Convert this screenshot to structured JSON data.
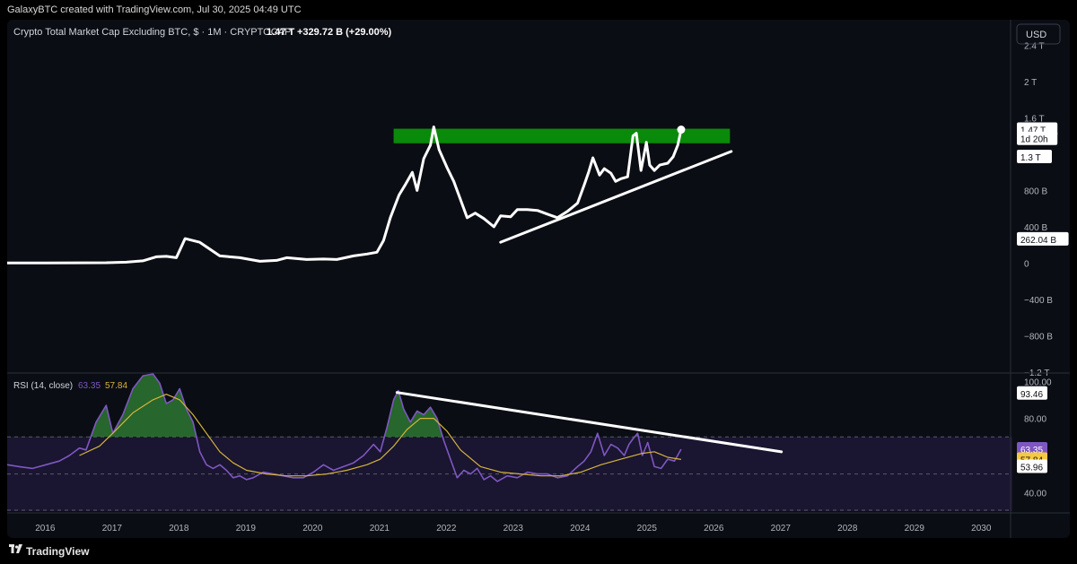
{
  "header": {
    "credit": "GalaxyBTC created with TradingView.com, Jul 30, 2025 04:49 UTC"
  },
  "footer": {
    "brand": "TradingView"
  },
  "colors": {
    "panel": "#0b0d14",
    "price_line": "#ffffff",
    "resistance_zone": "#0a8a0a",
    "rsi_line": "#7e57c2",
    "rsi_ma": "#d4b43c",
    "rsi_band": "#1a1530",
    "overbought_fill": "#2e7d32"
  },
  "chart_data": [
    {
      "type": "line",
      "title": "Crypto Total Market Cap Excluding BTC, $ · 1M · CRYPTOCAP",
      "legend": {
        "last": "1.47 T",
        "change": "+329.72 B (+29.00%)"
      },
      "currency_button": "USD",
      "y_ticks": [
        "2.4 T",
        "2 T",
        "1.6 T",
        "1.2 T",
        "800 B",
        "400 B",
        "0",
        "−400 B",
        "−800 B",
        "−1.2 T"
      ],
      "y_tick_values": [
        2400,
        2000,
        1600,
        1200,
        800,
        400,
        0,
        -400,
        -800,
        -1200
      ],
      "ylim": [
        -1200,
        2680
      ],
      "y_unit": "B USD",
      "price_labels": [
        {
          "text": "1.47 T",
          "value": 1470
        },
        {
          "text": "1d 20h",
          "value": 1370
        },
        {
          "text": "1.3 T",
          "value": 1170
        },
        {
          "text": "262.04 B",
          "value": 262
        }
      ],
      "x_ticks": [
        "2016",
        "2017",
        "2018",
        "2019",
        "2020",
        "2021",
        "2022",
        "2023",
        "2024",
        "2025",
        "2026",
        "2027",
        "2028",
        "2029",
        "2030"
      ],
      "x_tick_years": [
        2016,
        2017,
        2018,
        2019,
        2020,
        2021,
        2022,
        2023,
        2024,
        2025,
        2026,
        2027,
        2028,
        2029,
        2030
      ],
      "xlim": [
        2015.42,
        2030.32
      ],
      "series": [
        {
          "x": [
            2015.42,
            2016.0,
            2016.5,
            2016.9,
            2017.2,
            2017.45,
            2017.65,
            2017.8,
            2017.95,
            2018.08,
            2018.3,
            2018.6,
            2018.9,
            2019.2,
            2019.45,
            2019.6,
            2019.9,
            2020.15,
            2020.35,
            2020.6,
            2020.8,
            2020.95,
            2021.05,
            2021.15,
            2021.28,
            2021.38,
            2021.48,
            2021.55,
            2021.65,
            2021.75,
            2021.8,
            2021.88,
            2022.0,
            2022.1,
            2022.2,
            2022.3,
            2022.42,
            2022.55,
            2022.7,
            2022.8,
            2022.95,
            2023.05,
            2023.2,
            2023.35,
            2023.5,
            2023.65,
            2023.8,
            2023.95,
            2024.05,
            2024.12,
            2024.18,
            2024.28,
            2024.35,
            2024.45,
            2024.52,
            2024.6,
            2024.7,
            2024.78,
            2024.83,
            2024.9,
            2024.98,
            2025.03,
            2025.1,
            2025.18,
            2025.3,
            2025.38,
            2025.45,
            2025.5
          ],
          "y": [
            2,
            2,
            3,
            4,
            10,
            25,
            70,
            75,
            60,
            270,
            230,
            80,
            60,
            20,
            30,
            60,
            40,
            45,
            40,
            80,
            100,
            120,
            250,
            500,
            750,
            870,
            1000,
            800,
            1150,
            1300,
            1500,
            1250,
            1050,
            900,
            700,
            500,
            550,
            490,
            400,
            520,
            510,
            590,
            590,
            580,
            540,
            500,
            570,
            660,
            860,
            1010,
            1160,
            970,
            1040,
            990,
            900,
            930,
            950,
            1400,
            1430,
            1020,
            1330,
            1080,
            1020,
            1080,
            1100,
            1170,
            1300,
            1470
          ],
          "last_marker": {
            "x": 2025.5,
            "y": 1470
          }
        }
      ],
      "resistance_zone": {
        "x": [
          2021.2,
          2026.23
        ],
        "y": [
          1320,
          1480
        ]
      },
      "support_trendline": {
        "x": [
          2022.8,
          2026.25
        ],
        "y": [
          230,
          1230
        ]
      }
    },
    {
      "type": "line",
      "title": "RSI (14, close)",
      "legend": {
        "rsi": "63.35",
        "ma": "57.84"
      },
      "y_ticks": [
        "100.00",
        "80.00",
        "40.00"
      ],
      "y_tick_values": [
        100,
        80,
        40
      ],
      "ylim": [
        30,
        104
      ],
      "upper_band": 70,
      "lower_band": 30,
      "labels": [
        {
          "text": "93.46",
          "value": 93.46
        },
        {
          "text": "63.35",
          "value": 63.35
        },
        {
          "text": "57.84",
          "value": 57.84
        },
        {
          "text": "53.96",
          "value": 53.96
        }
      ],
      "series": [
        {
          "name": "RSI",
          "x": [
            2015.42,
            2015.6,
            2015.8,
            2016.0,
            2016.2,
            2016.35,
            2016.5,
            2016.6,
            2016.75,
            2016.9,
            2017.0,
            2017.15,
            2017.3,
            2017.45,
            2017.6,
            2017.7,
            2017.8,
            2017.9,
            2018.0,
            2018.1,
            2018.2,
            2018.3,
            2018.4,
            2018.5,
            2018.6,
            2018.7,
            2018.8,
            2018.9,
            2019.0,
            2019.1,
            2019.25,
            2019.4,
            2019.55,
            2019.7,
            2019.85,
            2020.0,
            2020.15,
            2020.3,
            2020.45,
            2020.6,
            2020.75,
            2020.9,
            2021.0,
            2021.1,
            2021.2,
            2021.27,
            2021.35,
            2021.45,
            2021.55,
            2021.65,
            2021.75,
            2021.85,
            2021.95,
            2022.05,
            2022.15,
            2022.25,
            2022.35,
            2022.45,
            2022.55,
            2022.65,
            2022.75,
            2022.9,
            2023.05,
            2023.2,
            2023.35,
            2023.5,
            2023.65,
            2023.8,
            2023.95,
            2024.05,
            2024.15,
            2024.25,
            2024.35,
            2024.45,
            2024.55,
            2024.65,
            2024.72,
            2024.78,
            2024.85,
            2024.92,
            2025.0,
            2025.1,
            2025.2,
            2025.3,
            2025.4,
            2025.5
          ],
          "y": [
            55,
            54,
            53,
            55,
            57,
            60,
            64,
            63,
            78,
            87,
            72,
            82,
            96,
            103,
            104,
            99,
            88,
            90,
            96,
            85,
            78,
            62,
            55,
            53,
            55,
            52,
            48,
            49,
            47,
            48,
            51,
            50,
            49,
            48,
            48,
            51,
            55,
            52,
            54,
            56,
            60,
            66,
            62,
            75,
            90,
            95,
            85,
            78,
            84,
            82,
            86,
            80,
            68,
            58,
            48,
            52,
            50,
            53,
            47,
            49,
            46,
            49,
            48,
            51,
            50,
            50,
            48,
            49,
            54,
            57,
            62,
            72,
            60,
            66,
            64,
            60,
            66,
            69,
            72,
            60,
            67,
            54,
            53,
            58,
            57,
            63.35
          ]
        },
        {
          "name": "RSI MA",
          "x": [
            2016.5,
            2016.8,
            2017.0,
            2017.3,
            2017.6,
            2017.8,
            2018.0,
            2018.2,
            2018.4,
            2018.6,
            2018.8,
            2019.0,
            2019.3,
            2019.6,
            2019.9,
            2020.2,
            2020.5,
            2020.8,
            2021.0,
            2021.2,
            2021.4,
            2021.6,
            2021.8,
            2022.0,
            2022.2,
            2022.5,
            2022.8,
            2023.1,
            2023.4,
            2023.7,
            2024.0,
            2024.3,
            2024.6,
            2024.9,
            2025.1,
            2025.3,
            2025.5
          ],
          "y": [
            60,
            65,
            72,
            83,
            90,
            93,
            90,
            82,
            72,
            62,
            56,
            52,
            50,
            49,
            49,
            50,
            52,
            55,
            58,
            65,
            74,
            80,
            80,
            73,
            63,
            54,
            51,
            50,
            49,
            49,
            51,
            55,
            58,
            61,
            62,
            59,
            57.84
          ]
        }
      ],
      "resistance_trendline": {
        "x": [
          2021.25,
          2027.0
        ],
        "y": [
          94,
          62
        ]
      }
    }
  ]
}
